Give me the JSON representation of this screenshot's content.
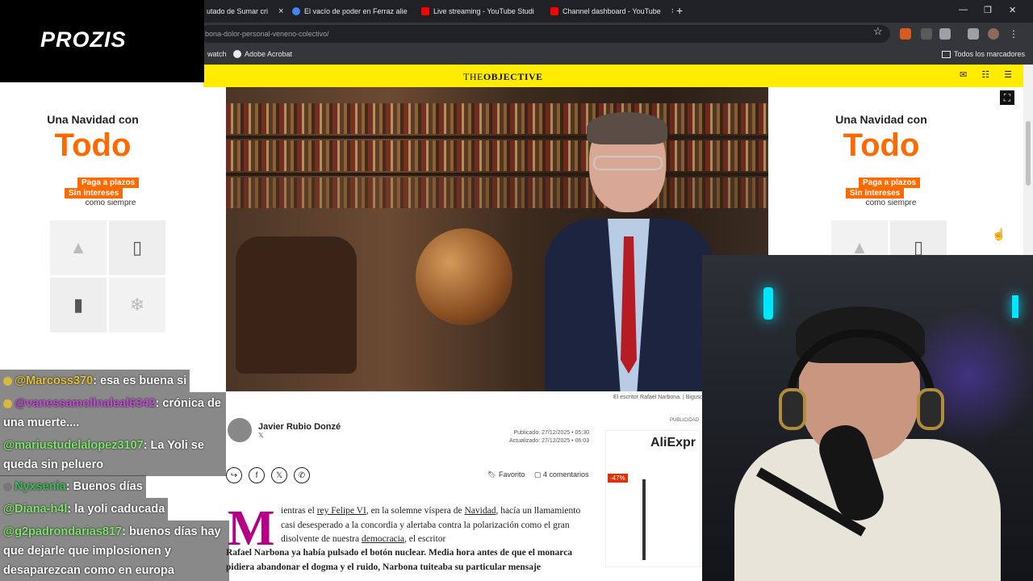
{
  "browser": {
    "tabs": [
      {
        "title": "utado de Sumar cri",
        "color": "#ff6d00"
      },
      {
        "title": "El vacío de poder en Ferraz alie",
        "color": "#4285f4"
      },
      {
        "title": "Live streaming - YouTube Studi",
        "color": "#ff0000"
      },
      {
        "title": "Channel dashboard - YouTube",
        "color": "#ff0000"
      }
    ],
    "new_tab": "+",
    "close_glyph": "×",
    "url": "bona-dolor-personal-veneno-colectivo/",
    "bookmarks": [
      "watch",
      "Adobe Acrobat"
    ],
    "all_bookmarks": "Todos los marcadores"
  },
  "overlay": {
    "brand": "PROZIS"
  },
  "site": {
    "logo_light": "THE",
    "logo_bold": "OBJECTIVE"
  },
  "ads": {
    "left": {
      "line1": "Una Navidad con",
      "line2": "Todo",
      "line3": "Paga a plazos",
      "line4": "Sin intereses",
      "line5": "como siempre"
    },
    "right": {
      "line1": "Una Navidad con",
      "line2": "Todo",
      "line3": "Paga a plazos",
      "line4": "Sin intereses",
      "line5": "como siempre"
    },
    "aliexpress": {
      "brand": "AliExpr",
      "discount": "-47%"
    },
    "label": "PUBLICIDAD"
  },
  "article": {
    "caption": "El escritor Rafael Narbona. | Bigusd",
    "author": "Javier Rubio Donzé",
    "author_social": "𝕏",
    "published": "Publicado: 27/12/2025 • 05:30",
    "updated": "Actualizado: 27/12/2025 • 06:03",
    "favorite": "Favorito",
    "comments": "4 comentarios",
    "dropcap": "M",
    "body_p1a": "ientras el",
    "body_link1": "rey Felipe VI",
    "body_p1b": ", en la solemne víspera de",
    "body_link2": "Navidad",
    "body_p1c": ", hacía un llamamiento casi desesperado a la concordia y alertaba contra la polarización como el gran disolvente de nuestra",
    "body_link3": "democracia",
    "body_p1d": ", el escritor",
    "body_bold": "Rafael Narbona ya había pulsado el botón nuclear. Media hora antes de que el monarca pidiera abandonar el dogma y el ruido, Narbona tuiteaba su particular mensaje"
  },
  "chat": [
    {
      "user": "@Marcoss370",
      "text": ": esa es buena si"
    },
    {
      "user": "@vanessamolinaleal6342",
      "text": ": crónica de una muerte...."
    },
    {
      "user": "@mariustudelalopez3107",
      "text": ": La Yoli se queda sin peluero"
    },
    {
      "user": "Nyxsenia",
      "text": ": Buenos días"
    },
    {
      "user": "@Diana-h4l",
      "text": ": la yoli caducada"
    },
    {
      "user": "@g2padrondarias817",
      "text": ": buenos días hay que dejarle que implosionen y desaparezcan como en europa"
    }
  ],
  "colors": {
    "accent_yellow": "#ffec00",
    "orange": "#ff6a00",
    "magenta": "#b30086"
  }
}
